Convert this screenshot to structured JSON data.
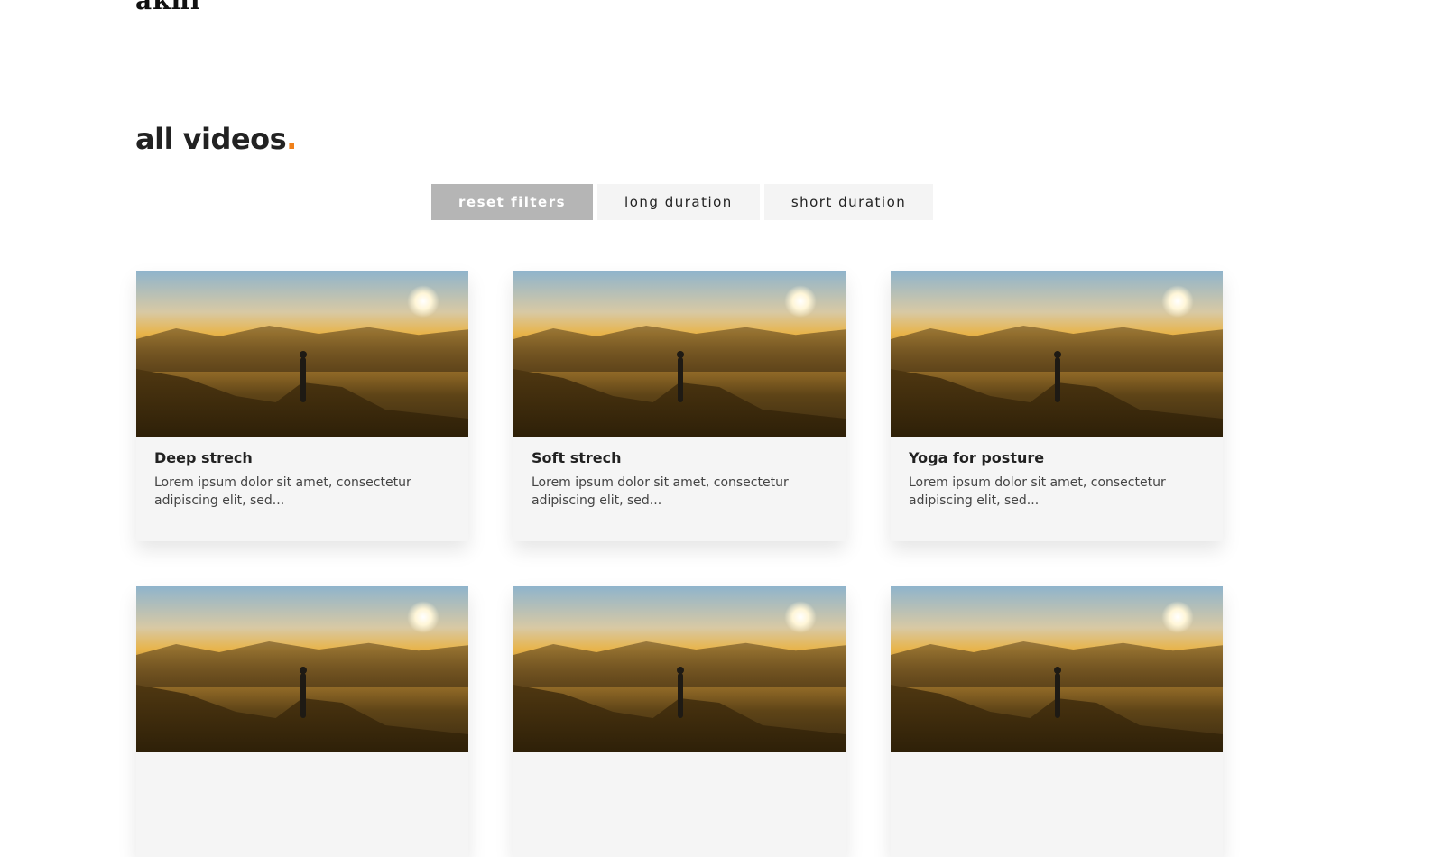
{
  "header": {
    "logo": "akhi"
  },
  "section": {
    "title": "all videos",
    "title_dot": "."
  },
  "filters": {
    "reset": "reset filters",
    "long": "long duration",
    "short": "short duration"
  },
  "cards": [
    {
      "title": "Deep strech",
      "desc": "Lorem ipsum dolor sit amet, consectetur adipiscing elit, sed..."
    },
    {
      "title": "Soft strech",
      "desc": "Lorem ipsum dolor sit amet, consectetur adipiscing elit, sed..."
    },
    {
      "title": "Yoga for posture",
      "desc": "Lorem ipsum dolor sit amet, consectetur adipiscing elit, sed..."
    },
    {
      "title": "",
      "desc": ""
    },
    {
      "title": "",
      "desc": ""
    },
    {
      "title": "",
      "desc": ""
    }
  ],
  "colors": {
    "accent": "#f0801a",
    "active_filter": "#b5b5b5",
    "card_bg": "#f5f5f5"
  }
}
